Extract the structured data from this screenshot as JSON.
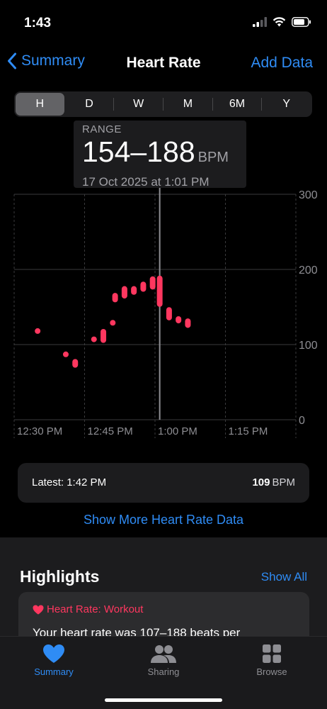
{
  "status_bar": {
    "time": "1:43"
  },
  "nav": {
    "back_label": "Summary",
    "title": "Heart Rate",
    "add_label": "Add Data"
  },
  "segments": [
    "H",
    "D",
    "W",
    "M",
    "6M",
    "Y"
  ],
  "selected_segment": "H",
  "tooltip": {
    "label": "RANGE",
    "value": "154–188",
    "unit": "BPM",
    "date": "17 Oct 2025 at 1:01 PM"
  },
  "chart_data": {
    "type": "range-scatter",
    "y_ticks": [
      "0",
      "100",
      "200",
      "300"
    ],
    "x_ticks": [
      "12:30 PM",
      "12:45 PM",
      "1:00 PM",
      "1:15 PM"
    ],
    "ylim": [
      0,
      300
    ],
    "x_range_minutes": [
      0,
      60
    ],
    "selected_minute": 31,
    "accent": "#ff375f",
    "points": [
      {
        "t": 5,
        "min": 118,
        "max": 118
      },
      {
        "t": 11,
        "min": 87,
        "max": 87
      },
      {
        "t": 13,
        "min": 73,
        "max": 77
      },
      {
        "t": 17,
        "min": 107,
        "max": 107
      },
      {
        "t": 19,
        "min": 106,
        "max": 117
      },
      {
        "t": 21,
        "min": 129,
        "max": 129
      },
      {
        "t": 21.5,
        "min": 160,
        "max": 165
      },
      {
        "t": 23.5,
        "min": 165,
        "max": 174
      },
      {
        "t": 25.5,
        "min": 170,
        "max": 174
      },
      {
        "t": 27.5,
        "min": 174,
        "max": 180
      },
      {
        "t": 29.5,
        "min": 177,
        "max": 187
      },
      {
        "t": 31,
        "min": 154,
        "max": 188
      },
      {
        "t": 33,
        "min": 136,
        "max": 146
      },
      {
        "t": 35,
        "min": 132,
        "max": 134
      },
      {
        "t": 37,
        "min": 126,
        "max": 131
      }
    ]
  },
  "latest": {
    "label": "Latest: 1:42 PM",
    "value": "109",
    "unit": "BPM"
  },
  "show_more": "Show More Heart Rate Data",
  "highlights": {
    "title": "Highlights",
    "show_all": "Show All",
    "card_title": "Heart Rate: Workout",
    "card_text": "Your heart rate was 107–188 beats per"
  },
  "tabs": [
    {
      "label": "Summary",
      "icon": "heart-icon"
    },
    {
      "label": "Sharing",
      "icon": "people-icon"
    },
    {
      "label": "Browse",
      "icon": "grid-icon"
    }
  ],
  "colors": {
    "accent_blue": "#2f8cf5",
    "heart_red": "#ff375f"
  }
}
